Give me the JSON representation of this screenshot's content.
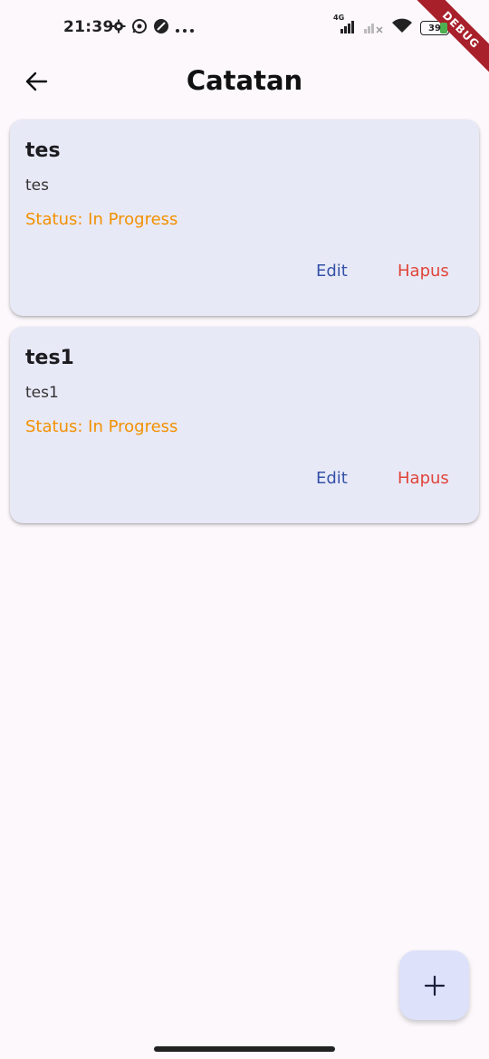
{
  "status_bar": {
    "time": "21:39",
    "network_label": "4G",
    "battery_level": "39",
    "left_icons": [
      "gear-icon",
      "whatsapp-icon",
      "app-icon",
      "more-dots-icon"
    ],
    "right_icons": [
      "signal-4g-icon",
      "signal-weak-icon",
      "wifi-icon",
      "battery-icon"
    ]
  },
  "debug_banner": "DEBUG",
  "app_bar": {
    "title": "Catatan",
    "back_icon": "arrow-left-icon"
  },
  "notes": [
    {
      "title": "tes",
      "description": "tes",
      "status": "Status: In Progress",
      "edit_label": "Edit",
      "delete_label": "Hapus"
    },
    {
      "title": "tes1",
      "description": "tes1",
      "status": "Status: In Progress",
      "edit_label": "Edit",
      "delete_label": "Hapus"
    }
  ],
  "fab": {
    "icon": "plus-icon"
  },
  "colors": {
    "background": "#fcf8fc",
    "card": "#e8e9f7",
    "status": "#f29100",
    "edit": "#3552a8",
    "delete": "#e0453a",
    "fab": "#dde1f9",
    "debug_ribbon": "#a8202a"
  }
}
